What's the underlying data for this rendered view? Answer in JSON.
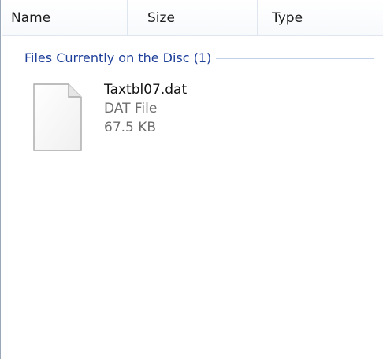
{
  "columns": {
    "name": "Name",
    "size": "Size",
    "type": "Type"
  },
  "group": {
    "title": "Files Currently on the Disc (1)"
  },
  "files": [
    {
      "name": "Taxtbl07.dat",
      "type": "DAT File",
      "size": "67.5 KB",
      "icon": "generic-file-icon"
    }
  ],
  "colors": {
    "group_title": "#1e3f9a",
    "group_line": "#c3d1ec",
    "secondary_text": "#6e6e6e"
  }
}
